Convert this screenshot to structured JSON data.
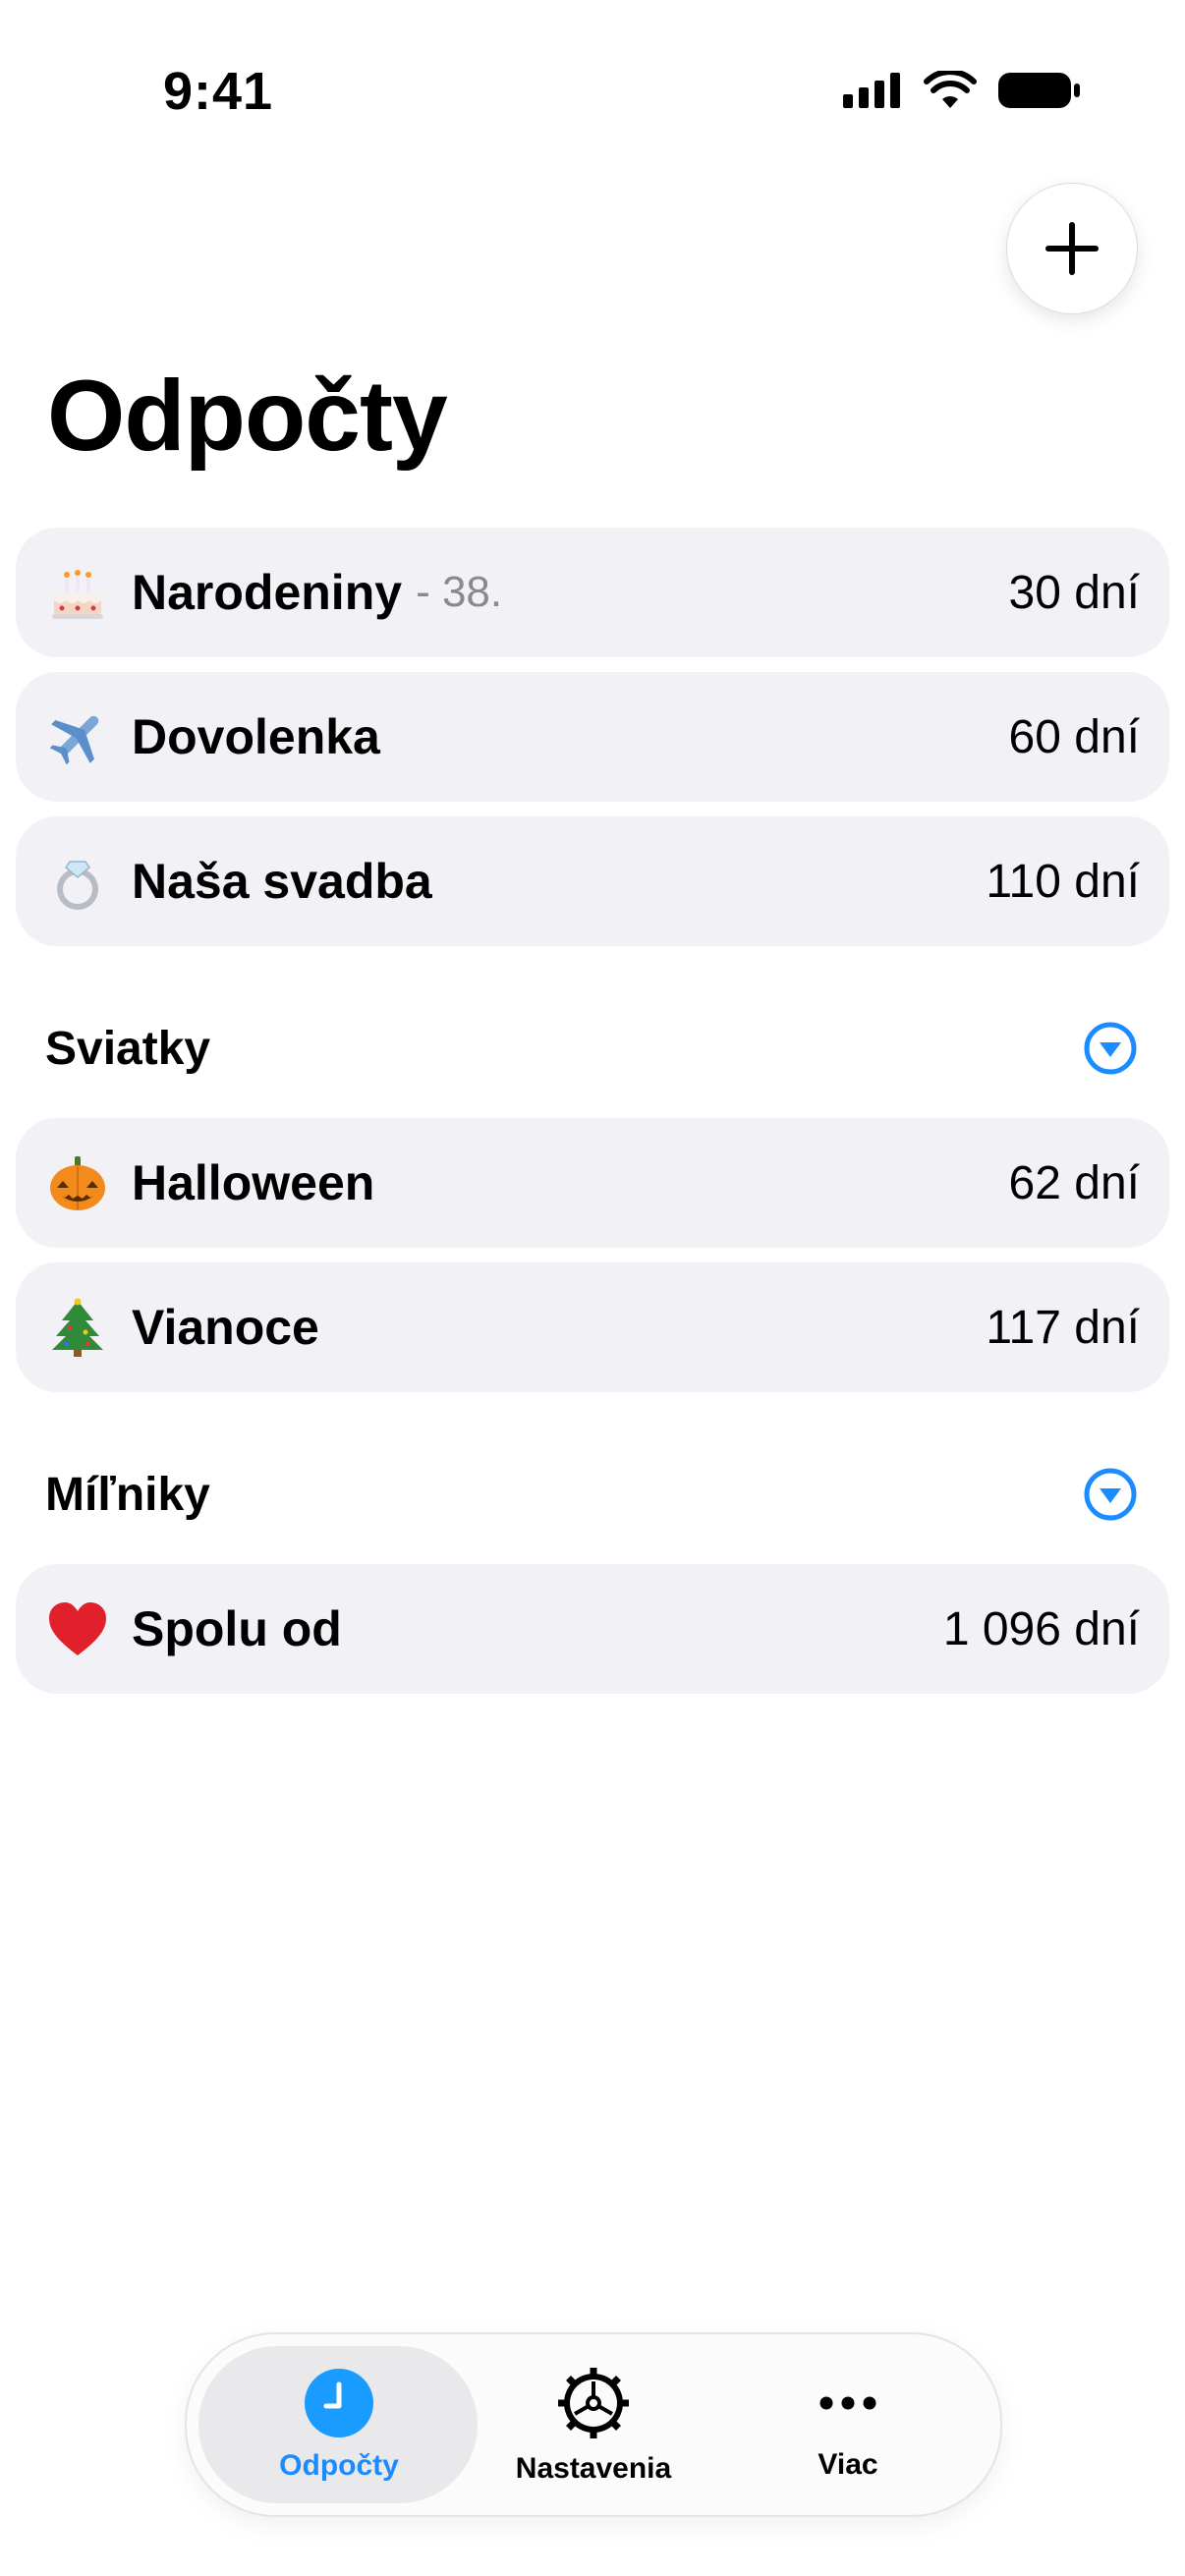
{
  "status_bar": {
    "time": "9:41"
  },
  "header": {
    "title": "Odpočty",
    "add_icon": "plus-icon"
  },
  "countdowns": [
    {
      "emoji": "🎂",
      "title": "Narodeniny",
      "subtitle": "- 38.",
      "days": "30 dní"
    },
    {
      "emoji": "✈️",
      "title": "Dovolenka",
      "subtitle": "",
      "days": "60 dní"
    },
    {
      "emoji": "💍",
      "title": "Naša svadba",
      "subtitle": "",
      "days": "110 dní"
    }
  ],
  "holidays": {
    "title": "Sviatky",
    "items": [
      {
        "emoji": "🎃",
        "title": "Halloween",
        "days": "62 dní"
      },
      {
        "emoji": "🎄",
        "title": "Vianoce",
        "days": "117 dní"
      }
    ]
  },
  "milestones": {
    "title": "Míľniky",
    "items": [
      {
        "emoji": "❤️",
        "title": "Spolu od",
        "days": "1 096 dní"
      }
    ]
  },
  "tabs": [
    {
      "label": "Odpočty",
      "icon": "clock-icon",
      "active": true
    },
    {
      "label": "Nastavenia",
      "icon": "gear-icon",
      "active": false
    },
    {
      "label": "Viac",
      "icon": "more-icon",
      "active": false
    }
  ],
  "colors": {
    "accent": "#1a8cff",
    "card_bg": "#f1f1f6",
    "secondary_text": "#8a8a8e"
  }
}
